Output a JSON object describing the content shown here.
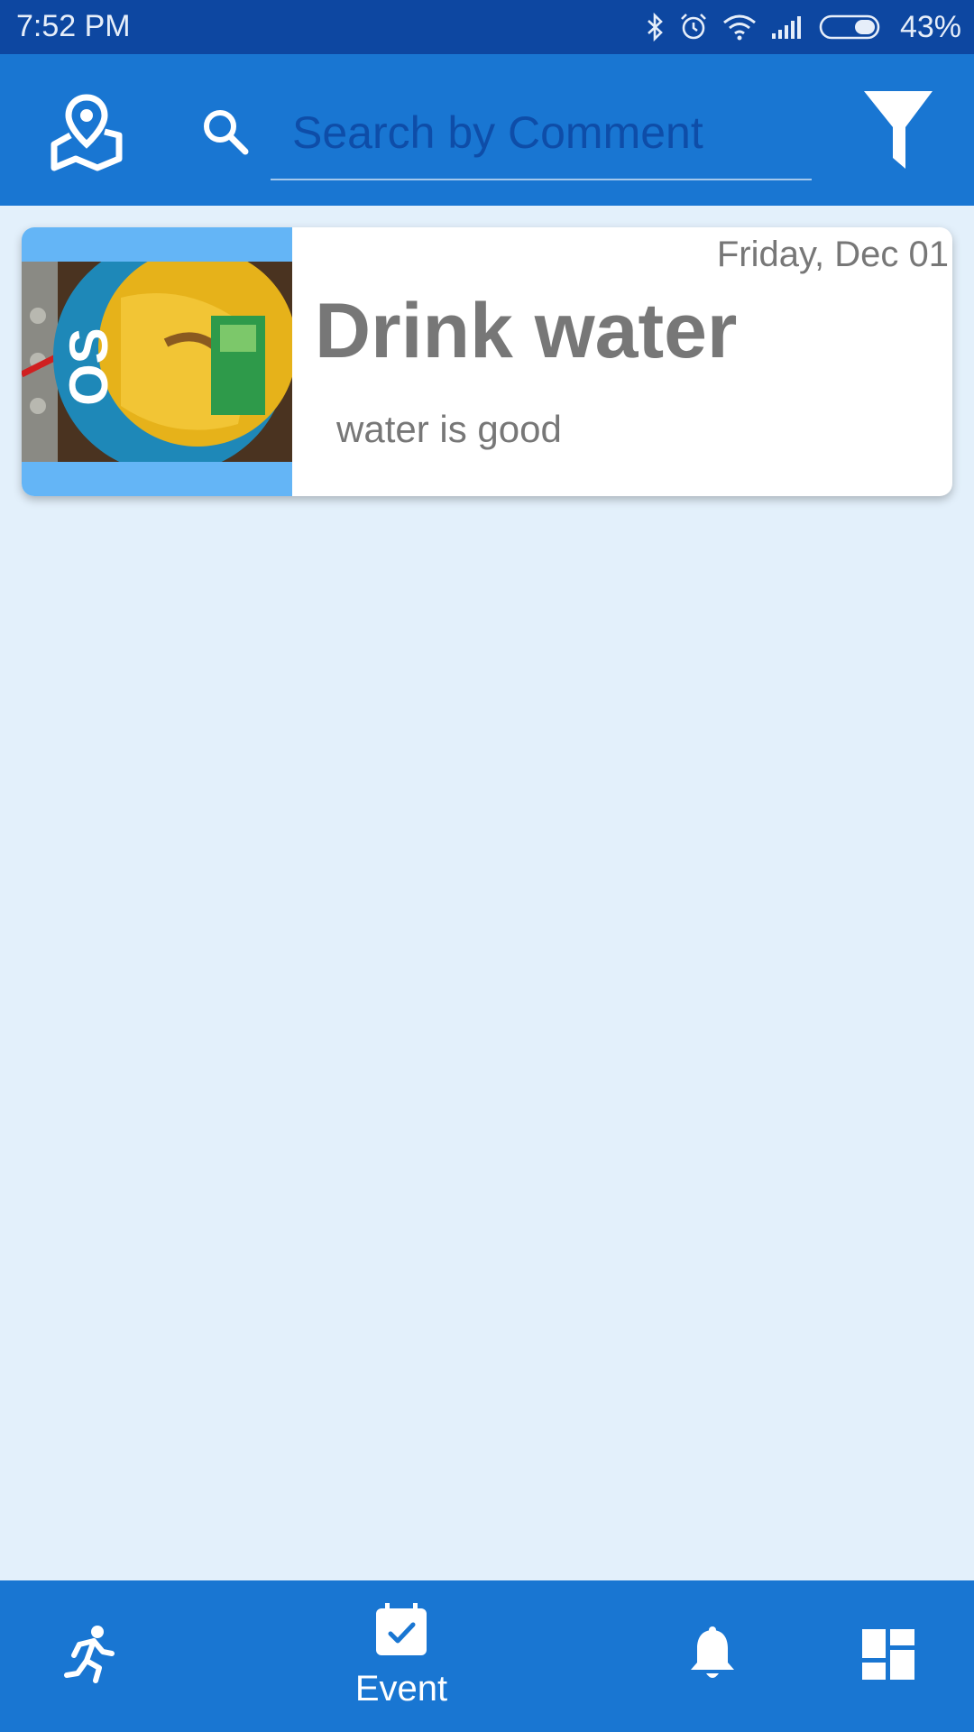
{
  "status_bar": {
    "time": "7:52 PM",
    "battery_percent": "43%",
    "icons": [
      "bluetooth-icon",
      "alarm-icon",
      "wifi-icon",
      "signal-icon",
      "battery-icon"
    ]
  },
  "app_bar": {
    "search_placeholder": "Search by Comment",
    "search_value": "",
    "icons": [
      "map-pin-icon",
      "search-icon",
      "filter-icon"
    ]
  },
  "events": [
    {
      "date": "Friday, Dec 01",
      "title": "Drink water",
      "comment": "water is good"
    }
  ],
  "bottom_nav": {
    "items": [
      {
        "icon": "running-icon",
        "label": ""
      },
      {
        "icon": "calendar-check-icon",
        "label": "Event"
      },
      {
        "icon": "bell-icon",
        "label": ""
      },
      {
        "icon": "dashboard-icon",
        "label": ""
      }
    ],
    "active_index": 1
  },
  "colors": {
    "status_bar": "#0D47A1",
    "primary": "#1976D2",
    "background": "#E3F0FB",
    "thumb_background": "#64B5F6",
    "text_gray": "#777777"
  }
}
